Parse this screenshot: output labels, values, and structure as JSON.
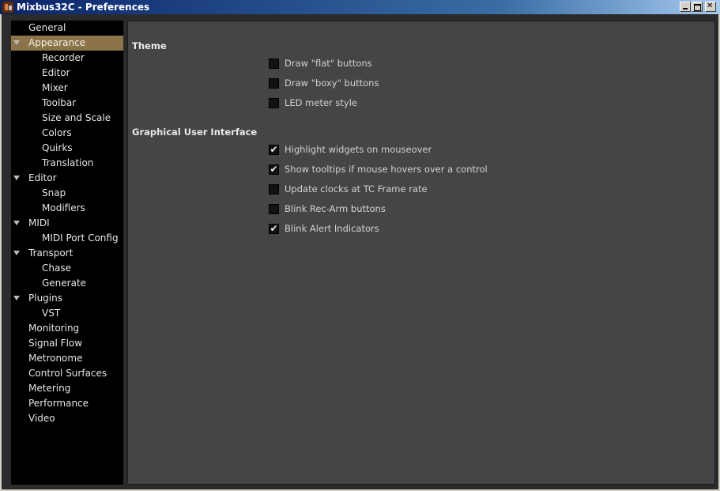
{
  "window": {
    "title": "Mixbus32C - Preferences"
  },
  "sidebar": {
    "items": [
      {
        "label": "General",
        "level": 0,
        "expandable": false,
        "selected": false
      },
      {
        "label": "Appearance",
        "level": 0,
        "expandable": true,
        "selected": true
      },
      {
        "label": "Recorder",
        "level": 1,
        "expandable": false,
        "selected": false
      },
      {
        "label": "Editor",
        "level": 1,
        "expandable": false,
        "selected": false
      },
      {
        "label": "Mixer",
        "level": 1,
        "expandable": false,
        "selected": false
      },
      {
        "label": "Toolbar",
        "level": 1,
        "expandable": false,
        "selected": false
      },
      {
        "label": "Size and Scale",
        "level": 1,
        "expandable": false,
        "selected": false
      },
      {
        "label": "Colors",
        "level": 1,
        "expandable": false,
        "selected": false
      },
      {
        "label": "Quirks",
        "level": 1,
        "expandable": false,
        "selected": false
      },
      {
        "label": "Translation",
        "level": 1,
        "expandable": false,
        "selected": false
      },
      {
        "label": "Editor",
        "level": 0,
        "expandable": true,
        "selected": false
      },
      {
        "label": "Snap",
        "level": 1,
        "expandable": false,
        "selected": false
      },
      {
        "label": "Modifiers",
        "level": 1,
        "expandable": false,
        "selected": false
      },
      {
        "label": "MIDI",
        "level": 0,
        "expandable": true,
        "selected": false
      },
      {
        "label": "MIDI Port Config",
        "level": 1,
        "expandable": false,
        "selected": false
      },
      {
        "label": "Transport",
        "level": 0,
        "expandable": true,
        "selected": false
      },
      {
        "label": "Chase",
        "level": 1,
        "expandable": false,
        "selected": false
      },
      {
        "label": "Generate",
        "level": 1,
        "expandable": false,
        "selected": false
      },
      {
        "label": "Plugins",
        "level": 0,
        "expandable": true,
        "selected": false
      },
      {
        "label": "VST",
        "level": 1,
        "expandable": false,
        "selected": false
      },
      {
        "label": "Monitoring",
        "level": 0,
        "expandable": false,
        "selected": false
      },
      {
        "label": "Signal Flow",
        "level": 0,
        "expandable": false,
        "selected": false
      },
      {
        "label": "Metronome",
        "level": 0,
        "expandable": false,
        "selected": false
      },
      {
        "label": "Control Surfaces",
        "level": 0,
        "expandable": false,
        "selected": false
      },
      {
        "label": "Metering",
        "level": 0,
        "expandable": false,
        "selected": false
      },
      {
        "label": "Performance",
        "level": 0,
        "expandable": false,
        "selected": false
      },
      {
        "label": "Video",
        "level": 0,
        "expandable": false,
        "selected": false
      }
    ]
  },
  "sections": [
    {
      "title": "Theme",
      "options": [
        {
          "label": "Draw \"flat\" buttons",
          "checked": false
        },
        {
          "label": "Draw \"boxy\" buttons",
          "checked": false
        },
        {
          "label": "LED meter style",
          "checked": false
        }
      ]
    },
    {
      "title": "Graphical User Interface",
      "options": [
        {
          "label": "Highlight widgets on mouseover",
          "checked": true
        },
        {
          "label": "Show tooltips if mouse hovers over a control",
          "checked": true
        },
        {
          "label": "Update clocks at TC Frame rate",
          "checked": false
        },
        {
          "label": "Blink Rec-Arm buttons",
          "checked": false
        },
        {
          "label": "Blink Alert Indicators",
          "checked": true
        }
      ]
    }
  ],
  "colors": {
    "selected_item_bg": "#8b7449",
    "panel_bg": "#464546",
    "sidebar_bg": "#000000"
  },
  "icons": {
    "check": "✔"
  }
}
